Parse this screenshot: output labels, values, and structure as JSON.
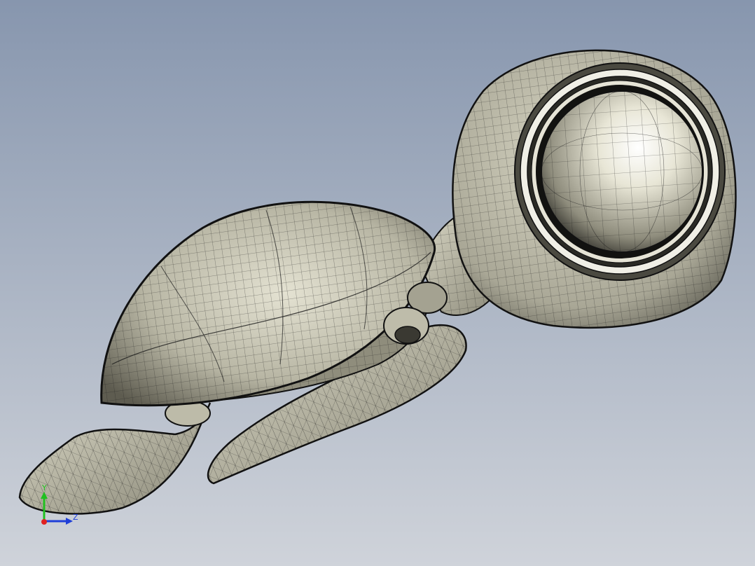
{
  "viewport": {
    "background_top": "#8796ae",
    "background_bottom": "#cfd3da",
    "model_fill": "#c9c7b4",
    "model_shade": "#6e6c5e",
    "mesh_color": "#1a1a1a"
  },
  "triad": {
    "x_color": "#e02020",
    "y_color": "#20c020",
    "z_color": "#1f3fd8",
    "y_label": "Y",
    "z_label": "Z"
  }
}
